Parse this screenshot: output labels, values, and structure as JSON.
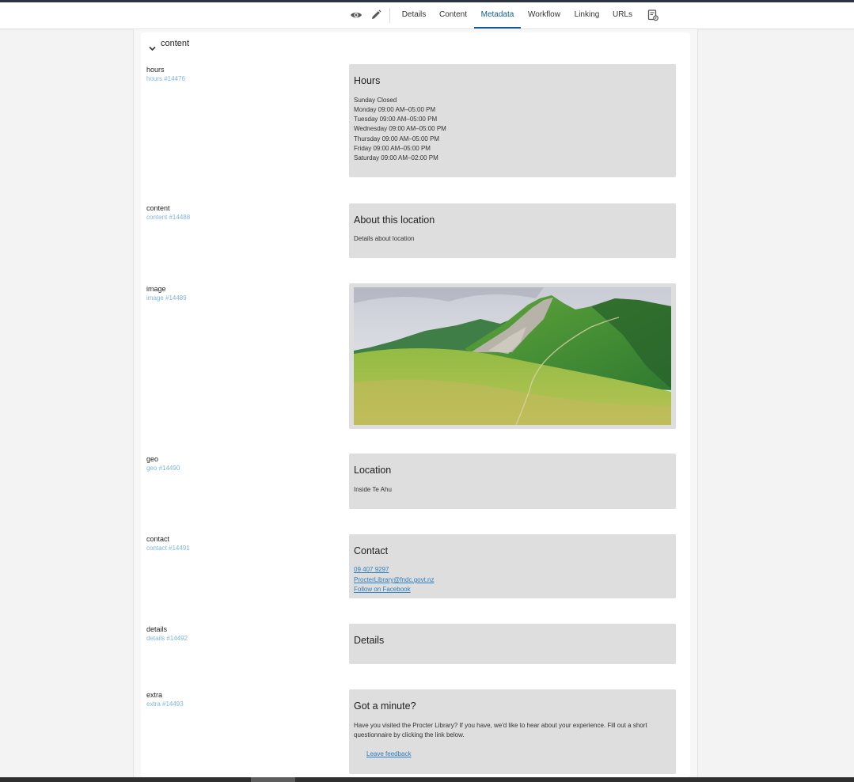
{
  "toolbar": {
    "icons": {
      "preview": "eye-icon",
      "edit": "pencil-icon",
      "settings": "page-settings-icon"
    },
    "tabs": [
      {
        "label": "Details"
      },
      {
        "label": "Content"
      },
      {
        "label": "Metadata",
        "active": true
      },
      {
        "label": "Workflow"
      },
      {
        "label": "Linking"
      },
      {
        "label": "URLs"
      }
    ],
    "accent": "#0f5d8f"
  },
  "section": {
    "title": "content",
    "icon": "chevron-down-icon"
  },
  "fields": {
    "hours": {
      "label": "hours",
      "ref": "hours #14476",
      "title": "Hours",
      "lines": [
        "Sunday Closed",
        "Monday 09:00 AM–05:00 PM",
        "Tuesday 09:00 AM–05:00 PM",
        "Wednesday 09:00 AM–05:00 PM",
        "Thursday 09:00 AM–05:00 PM",
        "Friday 09:00 AM–05:00 PM",
        "Saturday 09:00 AM–02:00 PM"
      ]
    },
    "content": {
      "label": "content",
      "ref": "content #14488",
      "title": "About this location",
      "body": "Details about location"
    },
    "image": {
      "label": "image",
      "ref": "image #14489"
    },
    "geo": {
      "label": "geo",
      "ref": "geo #14490",
      "title": "Location",
      "body": "Inside Te Ahu"
    },
    "contact": {
      "label": "contact",
      "ref": "contact #14491",
      "title": "Contact",
      "links": [
        "09 407 9297",
        "ProcterLibrary@fndc.govt.nz",
        "Follow on Facebook"
      ]
    },
    "details": {
      "label": "details",
      "ref": "details #14492",
      "title": "Details"
    },
    "extra": {
      "label": "extra",
      "ref": "extra #14493",
      "title": "Got a minute?",
      "body": "Have you visited the Procter Library? If you have, we'd like to hear about your experience. Fill out a short questionnaire by clicking the link below.",
      "link": "Leave feedback"
    }
  },
  "colors": {
    "card_bg": "#dedede",
    "link": "#2d7fc1",
    "ref_text": "#7fb6de"
  }
}
